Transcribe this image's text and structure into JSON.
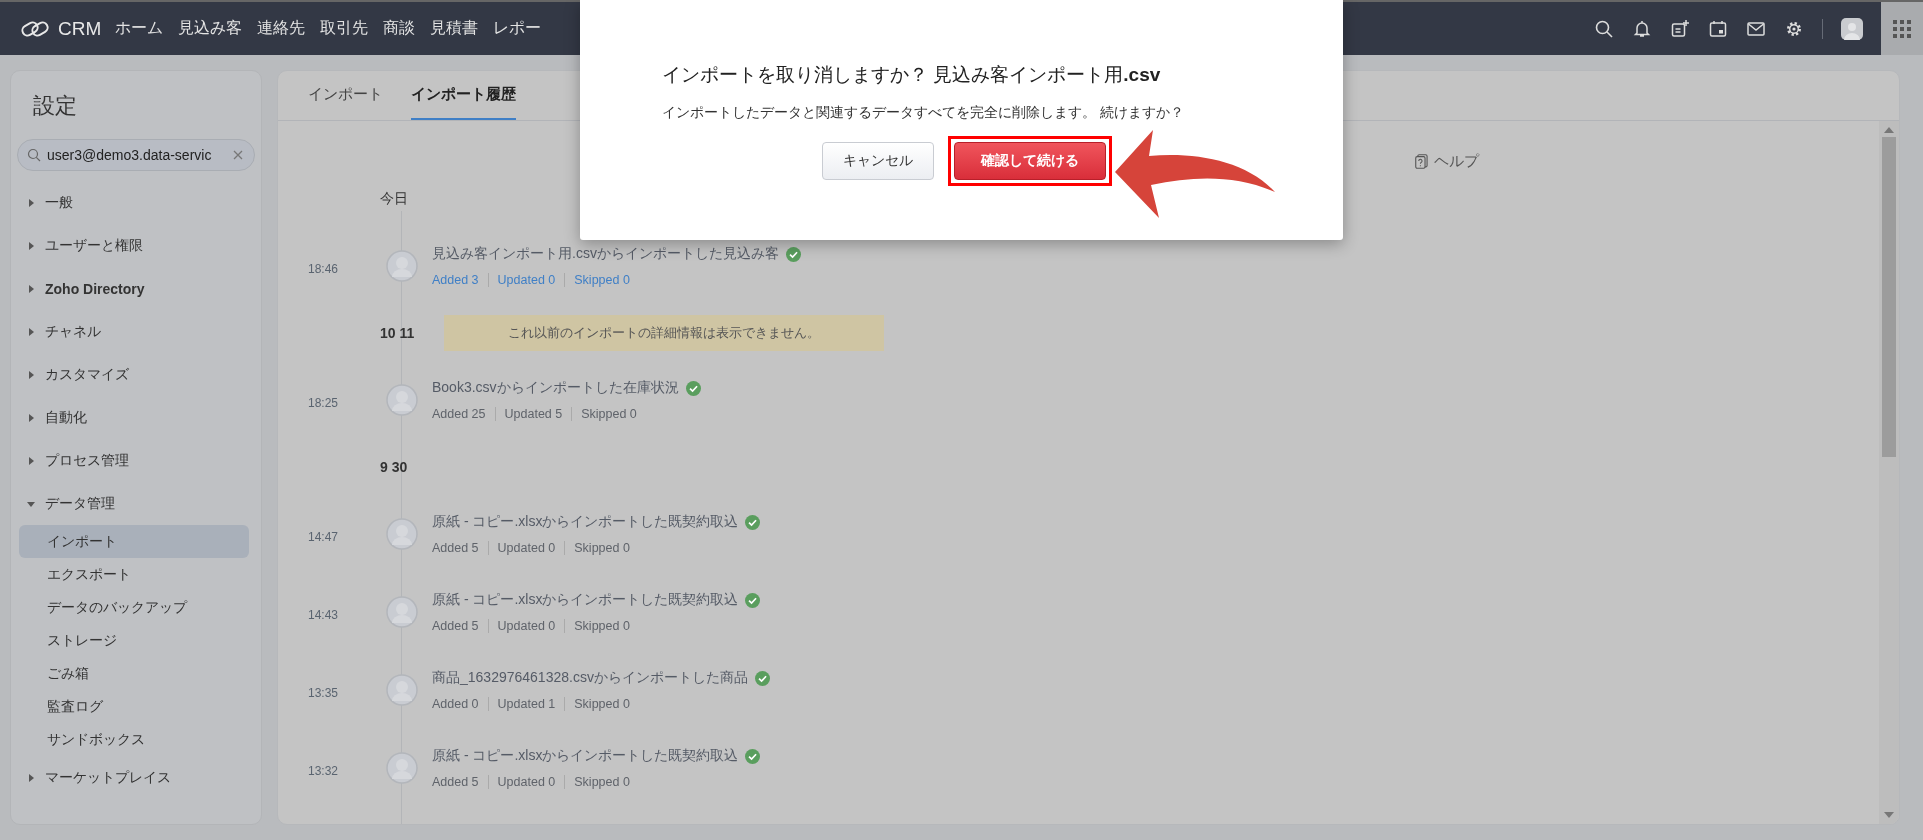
{
  "topbar": {
    "logo": "CRM",
    "nav": [
      "ホーム",
      "見込み客",
      "連絡先",
      "取引先",
      "商談",
      "見積書",
      "レポー"
    ]
  },
  "sidebar": {
    "title": "設定",
    "search": {
      "value": "user3@demo3.data-servic"
    },
    "items": [
      {
        "label": "一般",
        "bold": false,
        "expanded": false
      },
      {
        "label": "ユーザーと権限",
        "bold": false,
        "expanded": false
      },
      {
        "label": "Zoho Directory",
        "bold": true,
        "expanded": false
      },
      {
        "label": "チャネル",
        "bold": false,
        "expanded": false
      },
      {
        "label": "カスタマイズ",
        "bold": false,
        "expanded": false
      },
      {
        "label": "自動化",
        "bold": false,
        "expanded": false
      },
      {
        "label": "プロセス管理",
        "bold": false,
        "expanded": false
      },
      {
        "label": "データ管理",
        "bold": false,
        "expanded": true,
        "children": [
          {
            "label": "インポート",
            "selected": true
          },
          {
            "label": "エクスポート",
            "selected": false
          },
          {
            "label": "データのバックアップ",
            "selected": false
          },
          {
            "label": "ストレージ",
            "selected": false
          },
          {
            "label": "ごみ箱",
            "selected": false
          },
          {
            "label": "監査ログ",
            "selected": false
          },
          {
            "label": "サンドボックス",
            "selected": false
          }
        ]
      },
      {
        "label": "マーケットプレイス",
        "bold": false,
        "expanded": false
      }
    ]
  },
  "tabs": [
    {
      "label": "インポート",
      "selected": false
    },
    {
      "label": "インポート履歴",
      "selected": true
    }
  ],
  "help": "ヘルプ",
  "timeline": [
    {
      "kind": "date",
      "label": "今日"
    },
    {
      "kind": "entry",
      "time": "18:46",
      "title": "見込み客インポート用.csvからインポートした見込み客",
      "linked": true,
      "stats": [
        "Added 3",
        "Updated 0",
        "Skipped 0"
      ]
    },
    {
      "kind": "date",
      "label": "10 11",
      "notice": "これ以前のインポートの詳細情報は表示できません。"
    },
    {
      "kind": "entry",
      "time": "18:25",
      "title": "Book3.csvからインポートした在庫状況",
      "linked": false,
      "stats": [
        "Added 25",
        "Updated 5",
        "Skipped 0"
      ]
    },
    {
      "kind": "date",
      "label": "9 30"
    },
    {
      "kind": "entry",
      "time": "14:47",
      "title": "原紙 - コピー.xlsxからインポートした既契約取込",
      "linked": false,
      "stats": [
        "Added 5",
        "Updated 0",
        "Skipped 0"
      ]
    },
    {
      "kind": "entry",
      "time": "14:43",
      "title": "原紙 - コピー.xlsxからインポートした既契約取込",
      "linked": false,
      "stats": [
        "Added 5",
        "Updated 0",
        "Skipped 0"
      ]
    },
    {
      "kind": "entry",
      "time": "13:35",
      "title": "商品_1632976461328.csvからインポートした商品",
      "linked": false,
      "stats": [
        "Added 0",
        "Updated 1",
        "Skipped 0"
      ]
    },
    {
      "kind": "entry",
      "time": "13:32",
      "title": "原紙 - コピー.xlsxからインポートした既契約取込",
      "linked": false,
      "stats": [
        "Added 5",
        "Updated 0",
        "Skipped 0"
      ]
    }
  ],
  "dialog": {
    "title": "インポートを取り消しますか？ 見込み客インポート用**.csv**",
    "message": "インポートしたデータと関連するデータすべてを完全に削除します。 続けますか？",
    "buttons": [
      {
        "label": "キャンセル",
        "kind": "secondary",
        "highlighted": false
      },
      {
        "label": "確認して続ける",
        "kind": "primary",
        "highlighted": true
      }
    ]
  }
}
